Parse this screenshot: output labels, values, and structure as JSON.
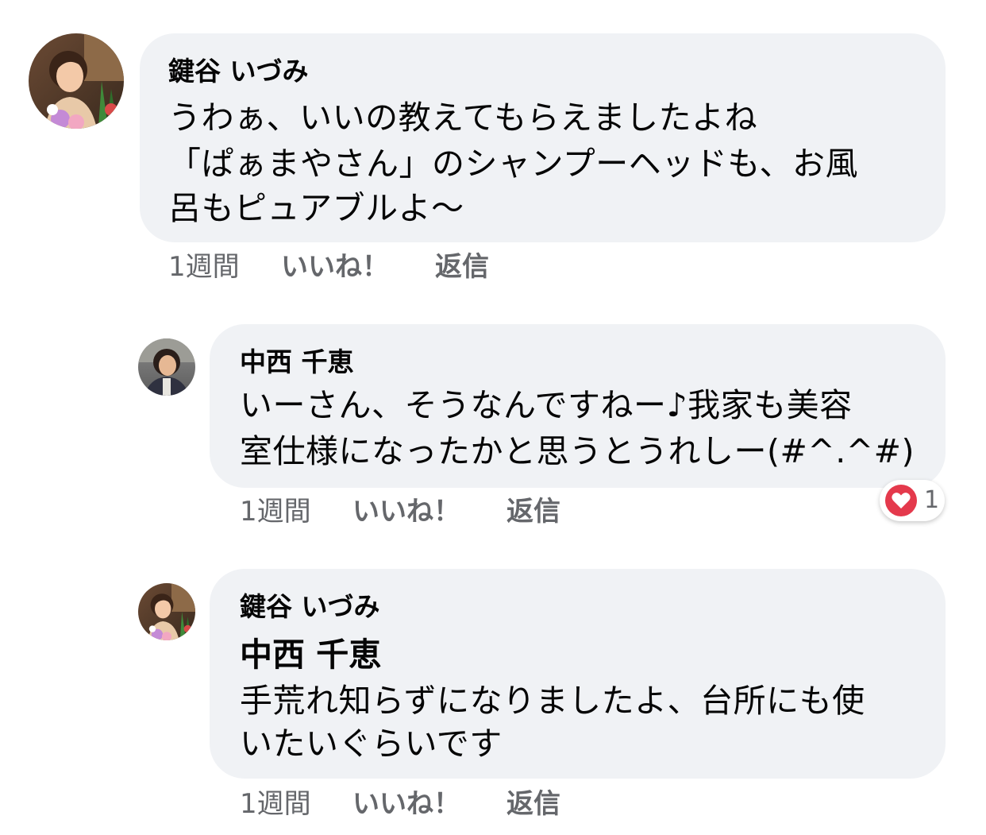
{
  "colors": {
    "bubble_bg": "#f0f2f5",
    "meta_text": "#65676b",
    "reaction_heart": "#e4394c"
  },
  "comments": [
    {
      "author": "鍵谷 いづみ",
      "avatar_icon": "profile-photo-woman-flowers",
      "lines": [
        "うわぁ、いいの教えてもらえましたよね",
        "「ぱぁまやさん」のシャンプーヘッドも、お風",
        "呂もピュアブルよ〜"
      ],
      "time": "1週間",
      "like_label": "いいね！",
      "reply_label": "返信"
    },
    {
      "author": "中西 千恵",
      "avatar_icon": "profile-photo-woman-dark-hair",
      "lines": [
        "いーさん、そうなんですねー♪我家も美容",
        "室仕様になったかと思うとうれしー(#^.^#)"
      ],
      "time": "1週間",
      "like_label": "いいね！",
      "reply_label": "返信",
      "reaction": {
        "icon": "heart-reaction-icon",
        "count": "1"
      }
    },
    {
      "author": "鍵谷 いづみ",
      "avatar_icon": "profile-photo-woman-flowers",
      "mention": "中西 千恵",
      "lines": [
        "手荒れ知らずになりましたよ、台所にも使",
        "いたいぐらいです"
      ],
      "time": "1週間",
      "like_label": "いいね！",
      "reply_label": "返信"
    }
  ]
}
